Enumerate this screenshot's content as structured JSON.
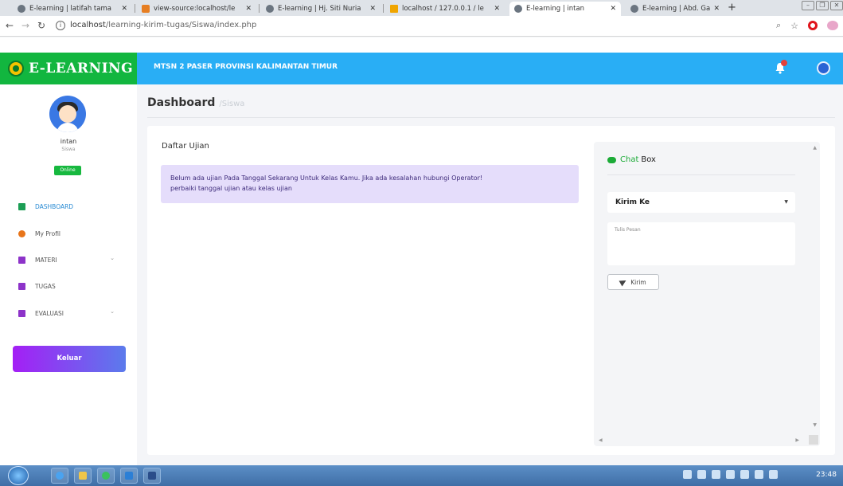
{
  "browser": {
    "tabs": [
      {
        "title": "E-learning | latifah tama"
      },
      {
        "title": "view-source:localhost/le"
      },
      {
        "title": "E-learning | Hj. Siti Nuria"
      },
      {
        "title": "localhost / 127.0.0.1 / le"
      },
      {
        "title": "E-learning | intan"
      },
      {
        "title": "E-learning | Abd. Gafur"
      }
    ],
    "url_host": "localhost",
    "url_path": "/learning-kirim-tugas/Siswa/index.php",
    "clock": "23:48"
  },
  "header": {
    "brand": "E-LEARNING",
    "school": "MTSN 2 PASER PROVINSI KALIMANTAN TIMUR"
  },
  "sidebar": {
    "user_name": "intan",
    "user_role": "Siswa",
    "status": "Online",
    "items": [
      {
        "label": "DASHBOARD",
        "icon": "dashboard-icon",
        "active": true
      },
      {
        "label": "My Profil",
        "icon": "profile-icon"
      },
      {
        "label": "MATERI",
        "icon": "document-icon",
        "has_submenu": true
      },
      {
        "label": "TUGAS",
        "icon": "document-icon"
      },
      {
        "label": "EVALUASI",
        "icon": "document-icon",
        "has_submenu": true
      }
    ],
    "logout_label": "Keluar"
  },
  "main": {
    "title": "Dashboard",
    "subtitle": "/Siswa",
    "section_title": "Daftar Ujian",
    "alert_line1": "Belum ada ujian Pada Tanggal Sekarang Untuk Kelas Kamu. Jika ada kesalahan hubungi Operator!",
    "alert_line2": "perbaiki tanggal ujian atau kelas ujian"
  },
  "chat": {
    "title_accent": "Chat",
    "title_rest": "Box",
    "recipient_selected": "Kirim Ke",
    "message_placeholder": "Tulis Pesan",
    "send_label": "Kirim"
  },
  "colors": {
    "brand_green": "#12b63f",
    "topbar_blue": "#29aef5",
    "alert_bg": "#e5ddfb",
    "logout_gradient_start": "#a41ff5",
    "logout_gradient_end": "#5b7bec",
    "chat_accent": "#1cab37"
  }
}
